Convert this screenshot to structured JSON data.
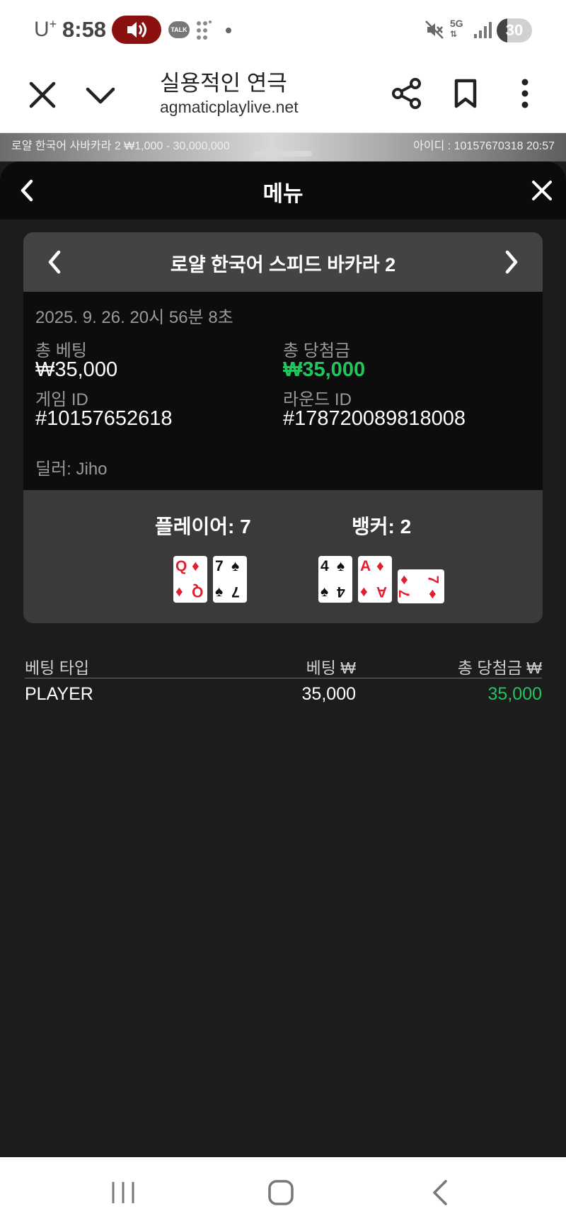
{
  "status_bar": {
    "carrier": "U",
    "carrier_sup": "+",
    "time": "8:58",
    "notification_talk": "TALK",
    "network": "5G",
    "battery_level": "30",
    "battery_fraction": 0.3
  },
  "browser": {
    "page_title": "실용적인 연극",
    "url": "agmaticplaylive.net"
  },
  "stream": {
    "left_text": "로얄 한국어 사바카라 2 ₩1,000 - 30,000,000",
    "right_text": "아이디 : 10157670318 20:57"
  },
  "menu": {
    "title": "메뉴"
  },
  "round": {
    "game_name": "로얄 한국어 스피드 바카라 2",
    "datetime": "2025. 9. 26. 20시 56분 8초",
    "total_bet_label": "총 베팅",
    "total_bet_value": "₩35,000",
    "total_win_label": "총 당첨금",
    "total_win_value": "₩35,000",
    "game_id_label": "게임 ID",
    "game_id_value": "#10157652618",
    "round_id_label": "라운드 ID",
    "round_id_value": "#178720089818008",
    "dealer": "딜러: Jiho"
  },
  "hands": {
    "player_label": "플레이어: 7",
    "banker_label": "뱅커: 2",
    "player_cards": [
      {
        "rank": "Q",
        "suit": "♦",
        "color": "red"
      },
      {
        "rank": "7",
        "suit": "♠",
        "color": "black"
      }
    ],
    "banker_cards": [
      {
        "rank": "4",
        "suit": "♠",
        "color": "black"
      },
      {
        "rank": "A",
        "suit": "♦",
        "color": "red"
      },
      {
        "rank": "7",
        "suit": "♦",
        "color": "red",
        "rotated": true
      }
    ]
  },
  "bets_table": {
    "headers": [
      "베팅 타입",
      "베팅 ₩",
      "총 당첨금 ₩"
    ],
    "rows": [
      {
        "type": "PLAYER",
        "bet": "35,000",
        "win": "35,000"
      }
    ]
  },
  "colors": {
    "accent_green": "#22c55e",
    "suit_red": "#e31f2e",
    "volume_pill": "#8b1010"
  }
}
